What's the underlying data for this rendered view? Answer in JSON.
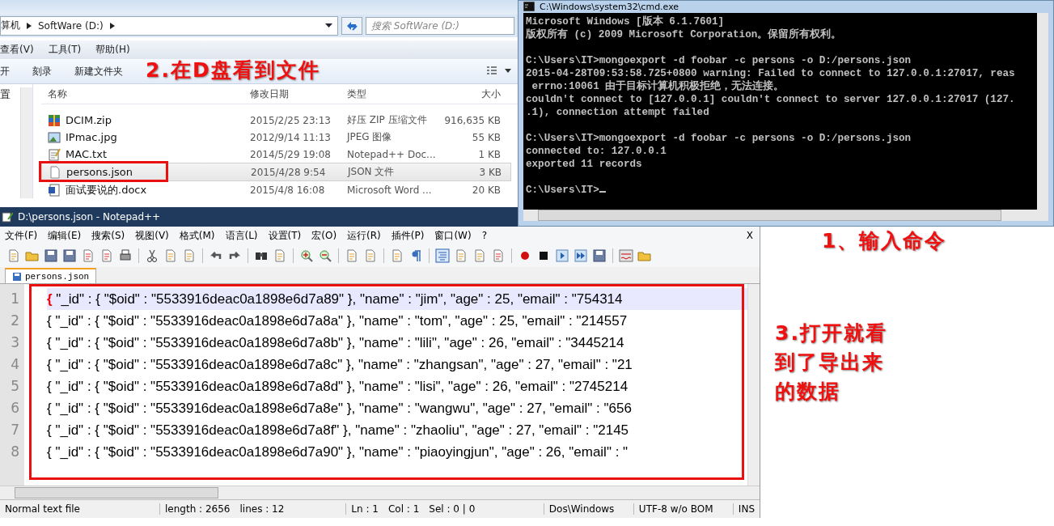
{
  "explorer": {
    "breadcrumb": [
      "算机",
      "SoftWare (D:)"
    ],
    "search": {
      "placeholder": "搜索 SoftWare (D:)"
    },
    "menu": [
      "查看(V)",
      "工具(T)",
      "帮助(H)"
    ],
    "toolbar": [
      "开",
      "刻录",
      "新建文件夹"
    ],
    "nav_pane": {
      "label": "置"
    },
    "columns": [
      "名称",
      "修改日期",
      "类型",
      "大小"
    ],
    "files": [
      {
        "kind": "zip",
        "name": "DCIM.zip",
        "date": "2015/2/25 23:13",
        "type": "好压 ZIP 压缩文件",
        "size": "916,635 KB",
        "selected": false
      },
      {
        "kind": "image",
        "name": "IPmac.jpg",
        "date": "2012/9/14 11:13",
        "type": "JPEG 图像",
        "size": "55 KB",
        "selected": false
      },
      {
        "kind": "text",
        "name": "MAC.txt",
        "date": "2014/5/29 19:08",
        "type": "Notepad++ Doc...",
        "size": "1 KB",
        "selected": false
      },
      {
        "kind": "blank",
        "name": "persons.json",
        "date": "2015/4/28 9:54",
        "type": "JSON 文件",
        "size": "3 KB",
        "selected": true
      },
      {
        "kind": "word",
        "name": "面试要说的.docx",
        "date": "2015/4/8 16:08",
        "type": "Microsoft Word ...",
        "size": "20 KB",
        "selected": false
      }
    ]
  },
  "cmd": {
    "title": "C:\\Windows\\system32\\cmd.exe",
    "blocks": [
      [
        "Microsoft Windows [版本 6.1.7601]",
        "版权所有 (c) 2009 Microsoft Corporation。保留所有权利。"
      ],
      [
        "C:\\Users\\IT>mongoexport -d foobar -c persons -o D:/persons.json",
        "2015-04-28T09:53:58.725+0800 warning: Failed to connect to 127.0.0.1:27017, reas",
        " errno:10061 由于目标计算机积极拒绝，无法连接。",
        "couldn't connect to [127.0.0.1] couldn't connect to server 127.0.0.1:27017 (127.",
        ".1), connection attempt failed"
      ],
      [
        "C:\\Users\\IT>mongoexport -d foobar -c persons -o D:/persons.json",
        "connected to: 127.0.0.1",
        "exported 11 records"
      ],
      [
        "C:\\Users\\IT>"
      ]
    ]
  },
  "notepad": {
    "title": "D:\\persons.json - Notepad++",
    "menu": [
      "文件(F)",
      "编辑(E)",
      "搜索(S)",
      "视图(V)",
      "格式(M)",
      "语言(L)",
      "设置(T)",
      "宏(O)",
      "运行(R)",
      "插件(P)",
      "窗口(W)",
      "?"
    ],
    "close_label": "X",
    "tabs": [
      {
        "label": "persons.json",
        "selected": true
      }
    ],
    "lines": [
      {
        "number": "1",
        "current": true,
        "brace_match": true,
        "text": "{ \"_id\" : { \"$oid\" : \"5533916deac0a1898e6d7a89\" }, \"name\" : \"jim\", \"age\" : 25, \"email\" : \"754314"
      },
      {
        "number": "2",
        "current": false,
        "brace_match": false,
        "text": "{ \"_id\" : { \"$oid\" : \"5533916deac0a1898e6d7a8a\" }, \"name\" : \"tom\", \"age\" : 25, \"email\" : \"214557"
      },
      {
        "number": "3",
        "current": false,
        "brace_match": false,
        "text": "{ \"_id\" : { \"$oid\" : \"5533916deac0a1898e6d7a8b\" }, \"name\" : \"lili\", \"age\" : 26, \"email\" : \"3445214"
      },
      {
        "number": "4",
        "current": false,
        "brace_match": false,
        "text": "{ \"_id\" : { \"$oid\" : \"5533916deac0a1898e6d7a8c\" }, \"name\" : \"zhangsan\", \"age\" : 27, \"email\" : \"21"
      },
      {
        "number": "5",
        "current": false,
        "brace_match": false,
        "text": "{ \"_id\" : { \"$oid\" : \"5533916deac0a1898e6d7a8d\" }, \"name\" : \"lisi\", \"age\" : 26, \"email\" : \"2745214"
      },
      {
        "number": "6",
        "current": false,
        "brace_match": false,
        "text": "{ \"_id\" : { \"$oid\" : \"5533916deac0a1898e6d7a8e\" }, \"name\" : \"wangwu\", \"age\" : 27, \"email\" : \"656"
      },
      {
        "number": "7",
        "current": false,
        "brace_match": false,
        "text": "{ \"_id\" : { \"$oid\" : \"5533916deac0a1898e6d7a8f\" }, \"name\" : \"zhaoliu\", \"age\" : 27, \"email\" : \"2145"
      },
      {
        "number": "8",
        "current": false,
        "brace_match": false,
        "text": "{ \"_id\" : { \"$oid\" : \"5533916deac0a1898e6d7a90\" }, \"name\" : \"piaoyingjun\", \"age\" : 26, \"email\" : \""
      }
    ],
    "status": [
      "Normal text file",
      "length : 2656",
      "lines : 12",
      "Ln : 1",
      "Col : 1",
      "Sel : 0 | 0",
      "Dos\\Windows",
      "UTF-8 w/o BOM",
      "INS"
    ]
  },
  "annotations": {
    "explorer_note": "2.在D盘看到文件",
    "console_note": "1、输入命令",
    "editor_note": "3.打开就看到了导出来的数据"
  }
}
